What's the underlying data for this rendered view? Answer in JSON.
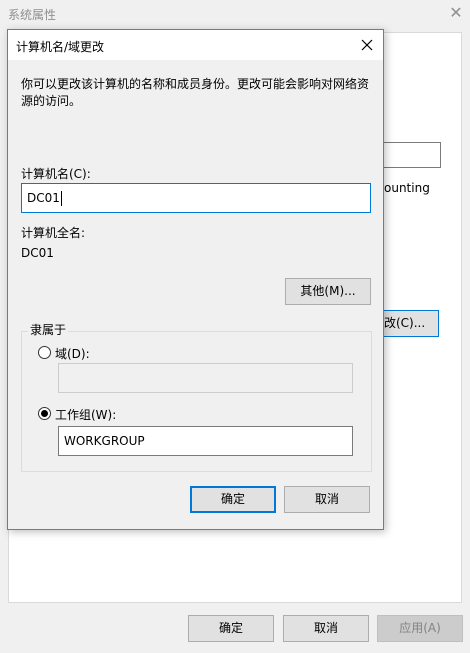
{
  "background_window": {
    "title": "系统属性",
    "partial_text": "ounting",
    "change_button_label": "改(C)...",
    "ok_label": "确定",
    "cancel_label": "取消",
    "apply_label": "应用(A)"
  },
  "dialog": {
    "title": "计算机名/域更改",
    "description": "你可以更改该计算机的名称和成员身份。更改可能会影响对网络资源的访问。",
    "computer_name_label": "计算机名(C):",
    "computer_name_value": "DC01",
    "full_name_label": "计算机全名:",
    "full_name_value": "DC01",
    "more_button_label": "其他(M)...",
    "member_of_legend": "隶属于",
    "domain_radio_label": "域(D):",
    "domain_value": "",
    "workgroup_radio_label": "工作组(W):",
    "workgroup_value": "WORKGROUP",
    "selected_membership": "workgroup",
    "ok_label": "确定",
    "cancel_label": "取消"
  },
  "colors": {
    "accent_focus": "#0078d7",
    "window_bg": "#f0f0f0",
    "disabled_text": "#838383"
  }
}
